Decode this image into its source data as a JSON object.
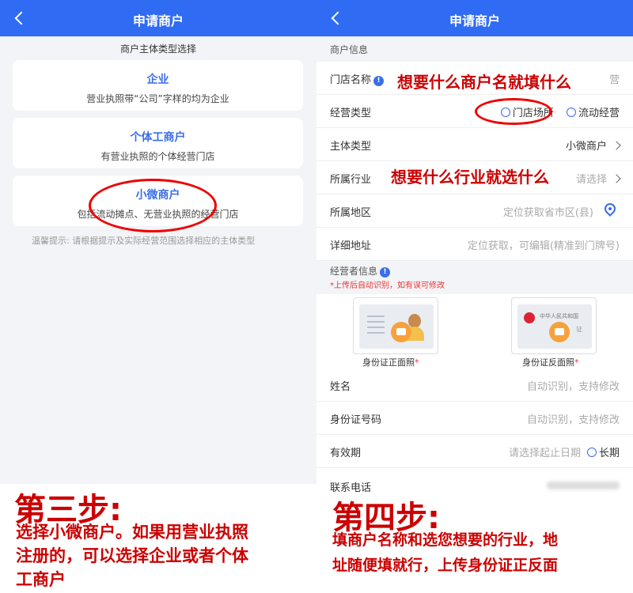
{
  "left": {
    "header": {
      "title": "申请商户"
    },
    "section_title": "商户主体类型选择",
    "cards": [
      {
        "title": "企业",
        "desc": "营业执照带“公司”字样的均为企业"
      },
      {
        "title": "个体工商户",
        "desc": "有营业执照的个体经营门店"
      },
      {
        "title": "小微商户",
        "desc": "包括流动摊点、无营业执照的经营门店"
      }
    ],
    "tip": "温馨提示: 请根据提示及实际经营范围选择相应的主体类型",
    "step_title": "第三步:",
    "step_text": [
      "选择小微商户。如果用营业执照",
      "注册的，可以选择企业或者个体",
      "工商户"
    ]
  },
  "right": {
    "header": {
      "title": "申请商户"
    },
    "merchant_section": "商户信息",
    "rows": {
      "store_name": {
        "label": "门店名称",
        "value": "营"
      },
      "biz_type": {
        "label": "经营类型",
        "option1": "门店场所",
        "option2": "流动经营"
      },
      "entity_type": {
        "label": "主体类型",
        "value": "小微商户"
      },
      "industry": {
        "label": "所属行业",
        "value": "请选择"
      },
      "region": {
        "label": "所属地区",
        "value": "定位获取省市区(县)"
      },
      "address": {
        "label": "详细地址",
        "value": "定位获取，可编辑(精准到门牌号)"
      }
    },
    "operator_section": "经营者信息",
    "operator_note": "*上传后自动识别，如有误可修改",
    "id_front": "身份证正面照",
    "id_back": "身份证反面照",
    "id_back_country": "中华人民共和国",
    "id_back_fragment": "证",
    "required_mark": "*",
    "info_badge": "!",
    "rows2": {
      "name": {
        "label": "姓名",
        "value": "自动识别，支持修改"
      },
      "id_no": {
        "label": "身份证号码",
        "value": "自动识别，支持修改"
      },
      "validity": {
        "label": "有效期",
        "value": "请选择起止日期",
        "option": "长期"
      },
      "phone": {
        "label": "联系电话"
      }
    },
    "annotations": {
      "store_name": "想要什么商户名就填什么",
      "industry": "想要什么行业就选什么"
    },
    "step_title": "第四步:",
    "step_text": [
      "填商户名称和选您想要的行业，地",
      "址随便填就行，上传身份证正反面"
    ]
  },
  "colors": {
    "brand_blue": "#2f6cf3",
    "annotation_red": "#cc0000"
  }
}
